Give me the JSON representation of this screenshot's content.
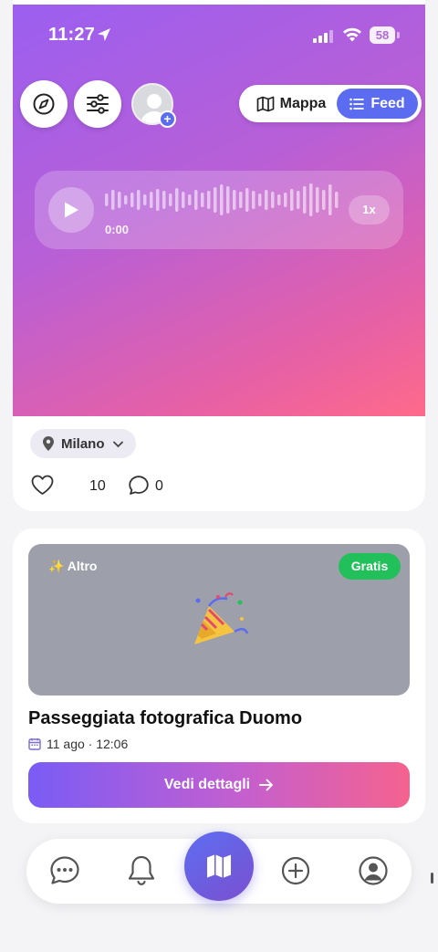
{
  "status_bar": {
    "time": "11:27",
    "battery": "58"
  },
  "header": {
    "toggle_map_label": "Mappa",
    "toggle_feed_label": "Feed"
  },
  "audio_player": {
    "time": "0:00",
    "speed": "1x"
  },
  "post": {
    "location": "Milano",
    "likes": "10",
    "comments": "0"
  },
  "event": {
    "category": "✨ Altro",
    "price_badge": "Gratis",
    "emoji": "🎉",
    "title": "Passeggiata fotografica Duomo",
    "date": "11 ago · 12:06",
    "cta_label": "Vedi dettagli"
  },
  "tabbar": {
    "items": [
      "chat-icon",
      "bell-icon",
      "map-icon",
      "plus-circle-icon",
      "profile-icon"
    ]
  },
  "colors": {
    "accent": "#5b6cf0",
    "gradient_start": "#9b5ff0",
    "gradient_end": "#ff6a8a",
    "free_badge": "#22c05a"
  }
}
